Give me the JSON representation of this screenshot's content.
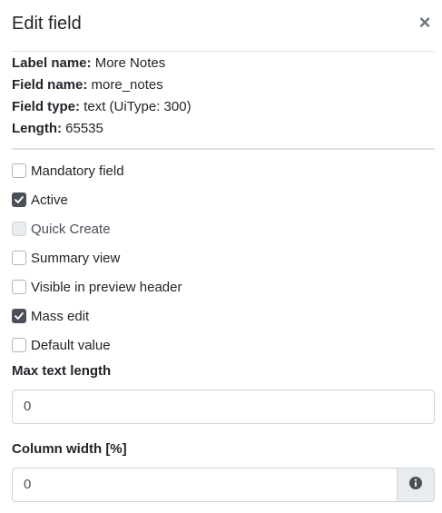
{
  "modal": {
    "title": "Edit field",
    "close_symbol": "×"
  },
  "field_info": [
    {
      "label": "Label name:",
      "value": "More Notes"
    },
    {
      "label": "Field name:",
      "value": "more_notes"
    },
    {
      "label": "Field type:",
      "value": "text (UiType: 300)"
    },
    {
      "label": "Length:",
      "value": "65535"
    }
  ],
  "options": [
    {
      "label": "Mandatory field",
      "checked": false,
      "disabled": false
    },
    {
      "label": "Active",
      "checked": true,
      "disabled": false
    },
    {
      "label": "Quick Create",
      "checked": false,
      "disabled": true
    },
    {
      "label": "Summary view",
      "checked": false,
      "disabled": false
    },
    {
      "label": "Visible in preview header",
      "checked": false,
      "disabled": false
    },
    {
      "label": "Mass edit",
      "checked": true,
      "disabled": false
    },
    {
      "label": "Default value",
      "checked": false,
      "disabled": false
    }
  ],
  "max_text_length": {
    "label": "Max text length",
    "value": "0"
  },
  "column_width": {
    "label": "Column width [%]",
    "value": "0",
    "addon_icon": "info-circle-icon"
  },
  "colors": {
    "checked_fill": "#495057",
    "border": "#ced4da",
    "addon_bg": "#e9ecef"
  }
}
